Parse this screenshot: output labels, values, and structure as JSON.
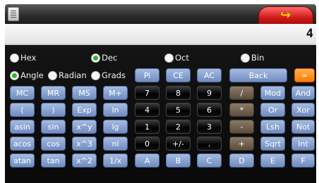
{
  "display": {
    "value": "4"
  },
  "base_modes": [
    {
      "label": "Hex",
      "selected": false
    },
    {
      "label": "Dec",
      "selected": true
    },
    {
      "label": "Oct",
      "selected": false
    },
    {
      "label": "Bin",
      "selected": false
    }
  ],
  "angle_modes": [
    {
      "label": "Angle",
      "selected": true
    },
    {
      "label": "Radian",
      "selected": false
    },
    {
      "label": "Grads",
      "selected": false
    }
  ],
  "row0": {
    "pi": "Pi",
    "ce": "CE",
    "ac": "AC",
    "back": "Back",
    "eq": "="
  },
  "rows": [
    [
      "MC",
      "MR",
      "MS",
      "M+",
      "7",
      "8",
      "9",
      "/",
      "Mod",
      "And"
    ],
    [
      "(",
      ")",
      "Exp",
      "ln",
      "4",
      "5",
      "6",
      "*",
      "Or",
      "Xor"
    ],
    [
      "asin",
      "sin",
      "x^y",
      "lg",
      "1",
      "2",
      "3",
      "-",
      "Lsh",
      "Not"
    ],
    [
      "acos",
      "cos",
      "x^3",
      "nl",
      "0",
      "+/-",
      ".",
      "+",
      "Sqrt",
      "Int"
    ],
    [
      "atan",
      "tan",
      "x^2",
      "1/x",
      "A",
      "B",
      "C",
      "D",
      "E",
      "F"
    ]
  ],
  "colors": {
    "blue": "#8aa3d0",
    "black": "#000000",
    "brown": "#6e5e4b",
    "orange": "#ff8c1a",
    "radio_on": "#2fb52f"
  }
}
